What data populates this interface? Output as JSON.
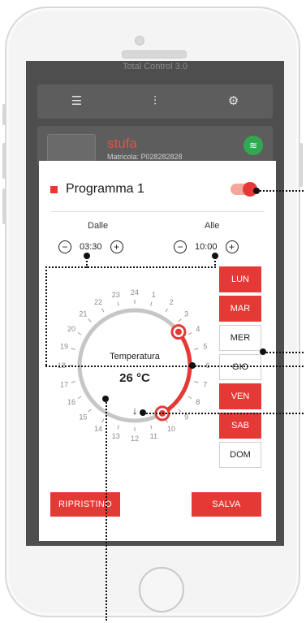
{
  "app": {
    "header_text": "Total Control 3.0",
    "toolbar_icons": [
      "list-icon",
      "sliders-icon",
      "settings-icon"
    ],
    "stove": {
      "name": "stufa",
      "serial": "Matricola: P028282828",
      "status_icon": "wifi-icon"
    }
  },
  "modal": {
    "title": "Programma 1",
    "enabled": true,
    "from_label": "Dalle",
    "to_label": "Alle",
    "from_value": "03:30",
    "to_value": "10:00",
    "minus_symbol": "⊖",
    "plus_symbol": "⊕",
    "dial": {
      "label": "Temperatura",
      "value": "26 °C",
      "hours": [
        "24",
        "1",
        "2",
        "3",
        "4",
        "5",
        "6",
        "7",
        "8",
        "9",
        "10",
        "11",
        "12",
        "13",
        "14",
        "15",
        "16",
        "17",
        "18",
        "19",
        "20",
        "21",
        "22",
        "23"
      ],
      "start_hour": 3.5,
      "end_hour": 10.0
    },
    "days": [
      {
        "label": "LUN",
        "active": true
      },
      {
        "label": "MAR",
        "active": true
      },
      {
        "label": "MER",
        "active": false
      },
      {
        "label": "GIO",
        "active": false
      },
      {
        "label": "VEN",
        "active": true
      },
      {
        "label": "SAB",
        "active": true
      },
      {
        "label": "DOM",
        "active": false
      }
    ],
    "reset_label": "RIPRISTINO",
    "save_label": "SALVA"
  },
  "colors": {
    "accent": "#e53935",
    "track": "#c6c6c6"
  }
}
